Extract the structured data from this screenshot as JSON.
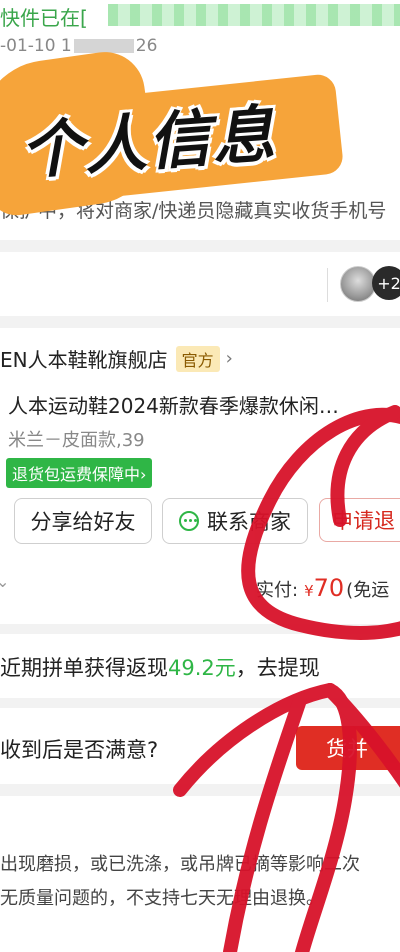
{
  "notice": {
    "title_fragment": "快件已在[",
    "title_suffix": "",
    "timestamp": "-01-10 1",
    "timestamp_suffix": "26",
    "privacy_text": "保护中，将对商家/快递员隐藏真实收货手机号"
  },
  "overlay": {
    "banner_text": "个人信息"
  },
  "avatars": {
    "more_label": "+2"
  },
  "store": {
    "name": "EN人本鞋靴旗舰店",
    "badge": "官方"
  },
  "product": {
    "title": "人本运动鞋2024新款春季爆款休闲…",
    "spec": "米兰－皮面款,39",
    "service_tag": "退货包运费保障中"
  },
  "actions": {
    "share_label": "分享给好友",
    "contact_label": "联系商家",
    "refund_label": "申请退"
  },
  "payment": {
    "label": "实付:",
    "currency": "¥",
    "amount": "70",
    "note": "(免运"
  },
  "cashback": {
    "prefix": "近期拼单获得返现",
    "amount": "49.2元",
    "suffix": "，去提现"
  },
  "satisfaction": {
    "question": "收到后是否满意?",
    "button_label": "货并"
  },
  "notes": {
    "line1": "出现磨损，或已洗涤，或吊牌已摘等影响二次",
    "line2": "无质量问题的，不支持七天无理由退换。"
  },
  "colors": {
    "green": "#3aa64b",
    "orange_overlay": "#f6a43a",
    "red_accent": "#e02e24",
    "red_scribble": "#d8122a"
  }
}
